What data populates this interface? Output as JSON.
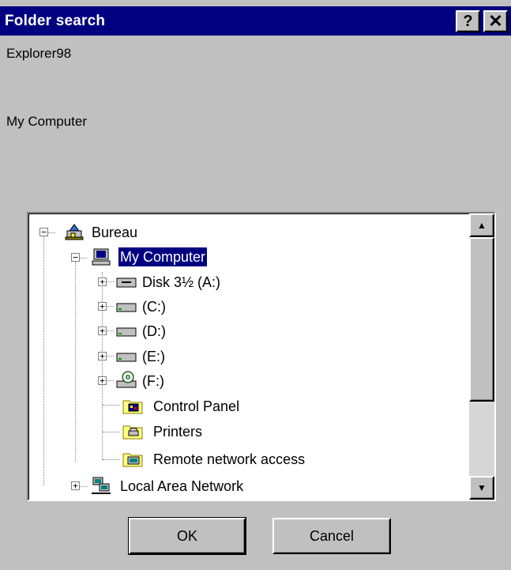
{
  "window": {
    "title": "Folder search",
    "help_label": "?",
    "close_label": "✕"
  },
  "app_name": "Explorer98",
  "selected_folder": "My Computer",
  "tree": {
    "items": [
      {
        "label": "Bureau",
        "icon": "desktop-icon",
        "expander": "−"
      },
      {
        "label": "My Computer",
        "icon": "computer-icon",
        "expander": "−",
        "selected": true
      },
      {
        "label": "Disk 3½ (A:)",
        "icon": "floppy-drive-icon",
        "expander": "+"
      },
      {
        "label": "(C:)",
        "icon": "hard-drive-icon",
        "expander": "+"
      },
      {
        "label": "(D:)",
        "icon": "hard-drive-icon",
        "expander": "+"
      },
      {
        "label": "(E:)",
        "icon": "hard-drive-icon",
        "expander": "+"
      },
      {
        "label": "(F:)",
        "icon": "cd-drive-icon",
        "expander": "+"
      },
      {
        "label": "Control Panel",
        "icon": "control-panel-folder-icon",
        "expander": ""
      },
      {
        "label": "Printers",
        "icon": "printers-folder-icon",
        "expander": ""
      },
      {
        "label": "Remote network access",
        "icon": "dialup-folder-icon",
        "expander": ""
      },
      {
        "label": "Local Area Network",
        "icon": "network-icon",
        "expander": "+"
      }
    ]
  },
  "scrollbar": {
    "up_arrow": "▲",
    "down_arrow": "▼"
  },
  "buttons": {
    "ok": "OK",
    "cancel": "Cancel"
  },
  "colors": {
    "titlebar": "#000080",
    "dialog_bg": "#c0c0c0",
    "selection": "#000080"
  }
}
